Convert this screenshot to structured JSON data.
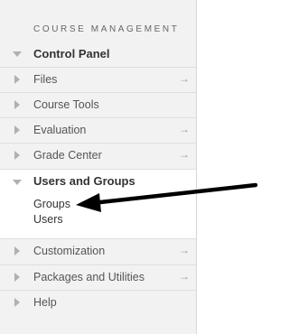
{
  "panel": {
    "heading": "COURSE MANAGEMENT",
    "control_panel_label": "Control Panel",
    "items": [
      {
        "label": "Files",
        "has_arrow": true
      },
      {
        "label": "Course Tools",
        "has_arrow": false
      },
      {
        "label": "Evaluation",
        "has_arrow": true
      },
      {
        "label": "Grade Center",
        "has_arrow": true
      }
    ],
    "users_and_groups": {
      "title": "Users and Groups",
      "links": [
        "Groups",
        "Users"
      ]
    },
    "bottom_items": [
      {
        "label": "Customization",
        "has_arrow": true
      },
      {
        "label": "Packages and Utilities",
        "has_arrow": true
      },
      {
        "label": "Help",
        "has_arrow": false
      }
    ],
    "arrow_glyph": "→"
  }
}
